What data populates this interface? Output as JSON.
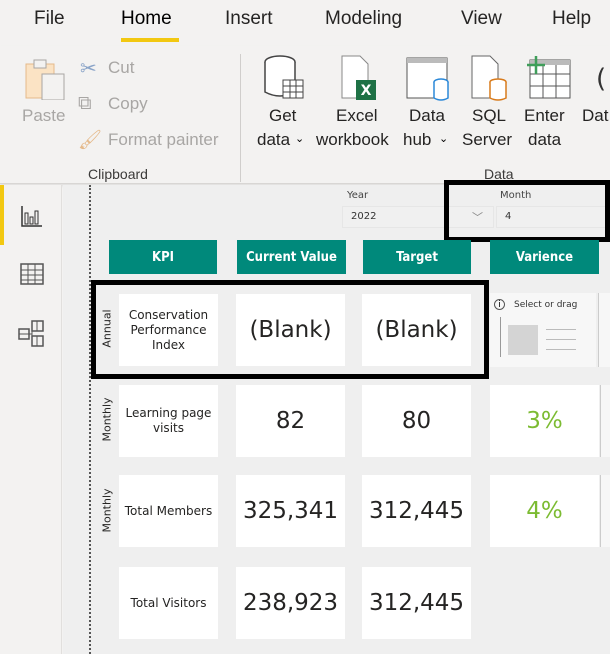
{
  "menu": {
    "tabs": [
      "File",
      "Home",
      "Insert",
      "Modeling",
      "View",
      "Help"
    ],
    "active": "Home"
  },
  "ribbon": {
    "clipboard": {
      "paste": "Paste",
      "cut": "Cut",
      "copy": "Copy",
      "format_painter": "Format painter",
      "group_label": "Clipboard"
    },
    "data": {
      "get_data": [
        "Get",
        "data"
      ],
      "excel": [
        "Excel",
        "workbook"
      ],
      "data_hub": [
        "Data",
        "hub"
      ],
      "sql": [
        "SQL",
        "Server"
      ],
      "enter_data": [
        "Enter",
        "data"
      ],
      "partial": "Dat",
      "group_label": "Data"
    }
  },
  "slicers": {
    "year": {
      "title": "Year",
      "value": "2022"
    },
    "month": {
      "title": "Month",
      "value": "4"
    }
  },
  "table": {
    "headers": [
      "KPI",
      "Current Value",
      "Target",
      "Varience"
    ],
    "rows": [
      {
        "period": "Annual",
        "kpi": "Conservation Performance Index",
        "current": "(Blank)",
        "target": "(Blank)",
        "variance": "",
        "variance_placeholder": "Select or drag"
      },
      {
        "period": "Monthly",
        "kpi": "Learning page visits",
        "current": "82",
        "target": "80",
        "variance": "3%"
      },
      {
        "period": "Monthly",
        "kpi": "Total Members",
        "current": "325,341",
        "target": "312,445",
        "variance": "4%"
      },
      {
        "period": "",
        "kpi": "Total Visitors",
        "current": "238,923",
        "target": "312,445",
        "variance": ""
      }
    ]
  },
  "colors": {
    "accent": "#00897b",
    "variance_positive": "#7cbb32",
    "tab_underline": "#f2c811"
  }
}
